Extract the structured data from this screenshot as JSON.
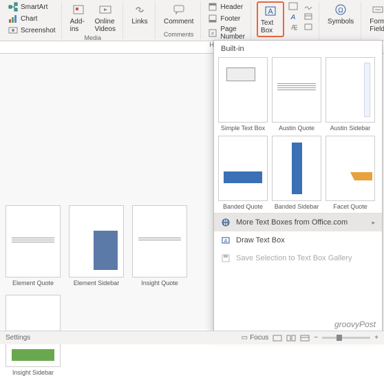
{
  "ribbon": {
    "smartart": "SmartArt",
    "chart": "Chart",
    "screenshot": "Screenshot",
    "addins": "Add-ins",
    "online_videos": "Online Videos",
    "links": "Links",
    "comment": "Comment",
    "header": "Header",
    "footer": "Footer",
    "page_number": "Page Number",
    "text_box": "Text Box",
    "symbols": "Symbols",
    "form_field": "Form Field",
    "groups": {
      "media": "Media",
      "comments": "Comments",
      "header_footer": "Header & …"
    }
  },
  "doc_gallery": [
    {
      "label": "Element Quote"
    },
    {
      "label": "Element Sidebar"
    },
    {
      "label": "Insight Quote"
    },
    {
      "label": "Insight Sidebar"
    }
  ],
  "dropdown": {
    "section": "Built-in",
    "items": [
      {
        "label": "Simple Text Box"
      },
      {
        "label": "Austin Quote"
      },
      {
        "label": "Austin Sidebar"
      },
      {
        "label": "Banded Quote"
      },
      {
        "label": "Banded Sidebar"
      },
      {
        "label": "Facet Quote"
      }
    ],
    "menu": {
      "more": "More Text Boxes from Office.com",
      "draw": "Draw Text Box",
      "save": "Save Selection to Text Box Gallery"
    }
  },
  "status": {
    "settings": "Settings",
    "focus": "Focus",
    "zoom_minus": "−",
    "zoom_plus": "+"
  },
  "watermark": "groovyPost"
}
